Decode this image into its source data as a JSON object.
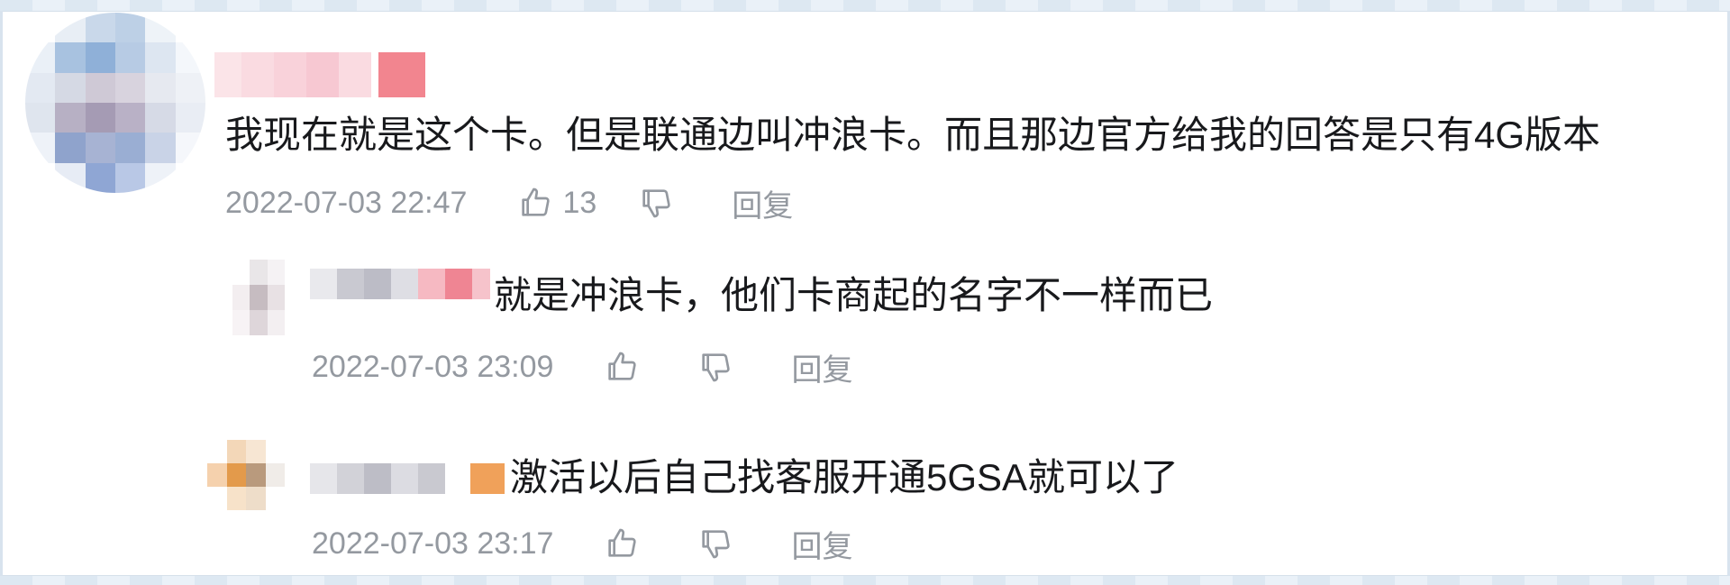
{
  "comments": {
    "main": {
      "text": "我现在就是这个卡。但是联通边叫冲浪卡。而且那边官方给我的回答是只有4G版本",
      "time": "2022-07-03 22:47",
      "like_count": "13",
      "reply_label": "回复",
      "icons": {
        "like": "thumbs-up-icon",
        "dislike": "thumbs-down-icon"
      }
    },
    "replies": [
      {
        "text": "就是冲浪卡，他们卡商起的名字不一样而已",
        "time": "2022-07-03 23:09",
        "reply_label": "回复"
      },
      {
        "text": "激活以后自己找客服开通5GSA就可以了",
        "time": "2022-07-03 23:17",
        "reply_label": "回复"
      }
    ]
  },
  "colors": {
    "text": "#18191c",
    "meta": "#9499a0",
    "highlight_name": "#f08a96"
  }
}
